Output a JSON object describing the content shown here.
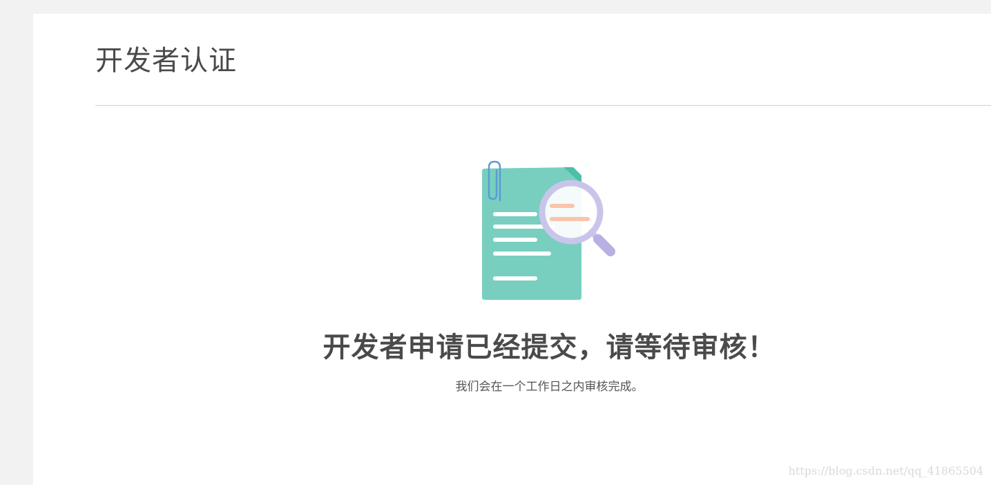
{
  "page": {
    "title": "开发者认证"
  },
  "status": {
    "headline": "开发者申请已经提交，请等待审核！",
    "subtext": "我们会在一个工作日之内审核完成。",
    "illustration_icon": "document-review-icon"
  },
  "watermark": {
    "text": "https://blog.csdn.net/qq_41865504"
  },
  "colors": {
    "page_background": "#f2f2f2",
    "panel_background": "#ffffff",
    "document": "#78cfbf",
    "document_fold": "#4dbfa8",
    "paperclip": "#5b9bd5",
    "magnifier": "#c9c5ea",
    "magnifier_lines": "#fbc4a8",
    "text": "#4a4a4a"
  }
}
